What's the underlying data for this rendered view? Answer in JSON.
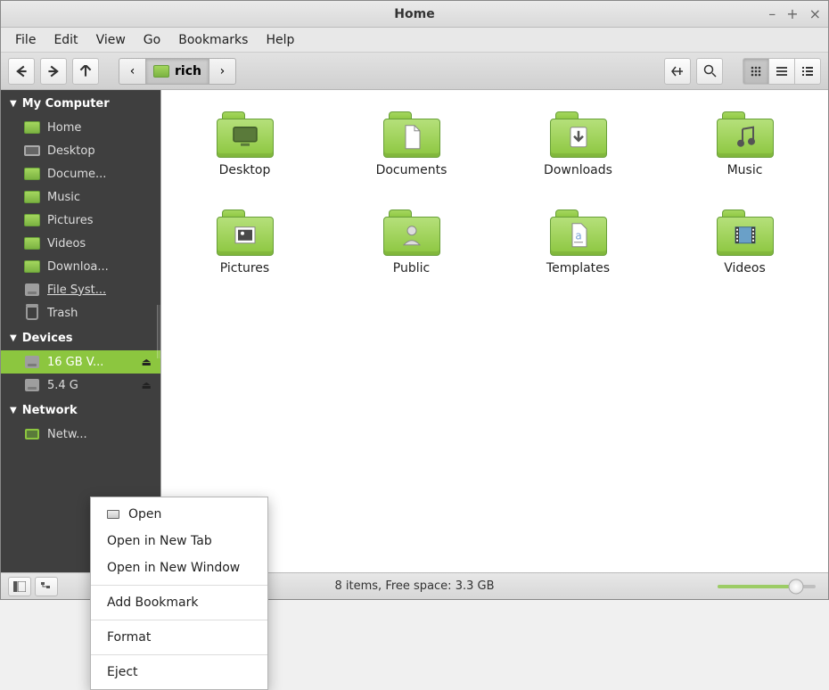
{
  "window": {
    "title": "Home"
  },
  "menubar": [
    "File",
    "Edit",
    "View",
    "Go",
    "Bookmarks",
    "Help"
  ],
  "toolbar": {
    "breadcrumb_label": "rich"
  },
  "sidebar": {
    "sections": [
      {
        "title": "My Computer",
        "items": [
          {
            "label": "Home",
            "icon": "folder"
          },
          {
            "label": "Desktop",
            "icon": "monitor"
          },
          {
            "label": "Docume...",
            "icon": "folder"
          },
          {
            "label": "Music",
            "icon": "folder"
          },
          {
            "label": "Pictures",
            "icon": "folder"
          },
          {
            "label": "Videos",
            "icon": "folder"
          },
          {
            "label": "Downloa...",
            "icon": "folder"
          },
          {
            "label": "File Syst...",
            "icon": "disk",
            "underline": true
          },
          {
            "label": "Trash",
            "icon": "trash"
          }
        ]
      },
      {
        "title": "Devices",
        "items": [
          {
            "label": "16 GB V...",
            "icon": "disk",
            "selected": true,
            "ejectable": true
          },
          {
            "label": "5.4 G",
            "icon": "disk",
            "ejectable": true
          }
        ]
      },
      {
        "title": "Network",
        "items": [
          {
            "label": "Netw...",
            "icon": "network"
          }
        ]
      }
    ]
  },
  "content": {
    "folders": [
      {
        "label": "Desktop",
        "emblem": "desktop"
      },
      {
        "label": "Documents",
        "emblem": "document"
      },
      {
        "label": "Downloads",
        "emblem": "download"
      },
      {
        "label": "Music",
        "emblem": "music"
      },
      {
        "label": "Pictures",
        "emblem": "picture"
      },
      {
        "label": "Public",
        "emblem": "public"
      },
      {
        "label": "Templates",
        "emblem": "template"
      },
      {
        "label": "Videos",
        "emblem": "video"
      }
    ]
  },
  "context_menu": {
    "items": [
      {
        "label": "Open",
        "icon": true
      },
      {
        "label": "Open in New Tab"
      },
      {
        "label": "Open in New Window"
      },
      {
        "sep": true
      },
      {
        "label": "Add Bookmark"
      },
      {
        "sep": true
      },
      {
        "label": "Format"
      },
      {
        "sep": true
      },
      {
        "label": "Eject"
      }
    ]
  },
  "statusbar": {
    "text": "8 items, Free space: 3.3 GB"
  }
}
